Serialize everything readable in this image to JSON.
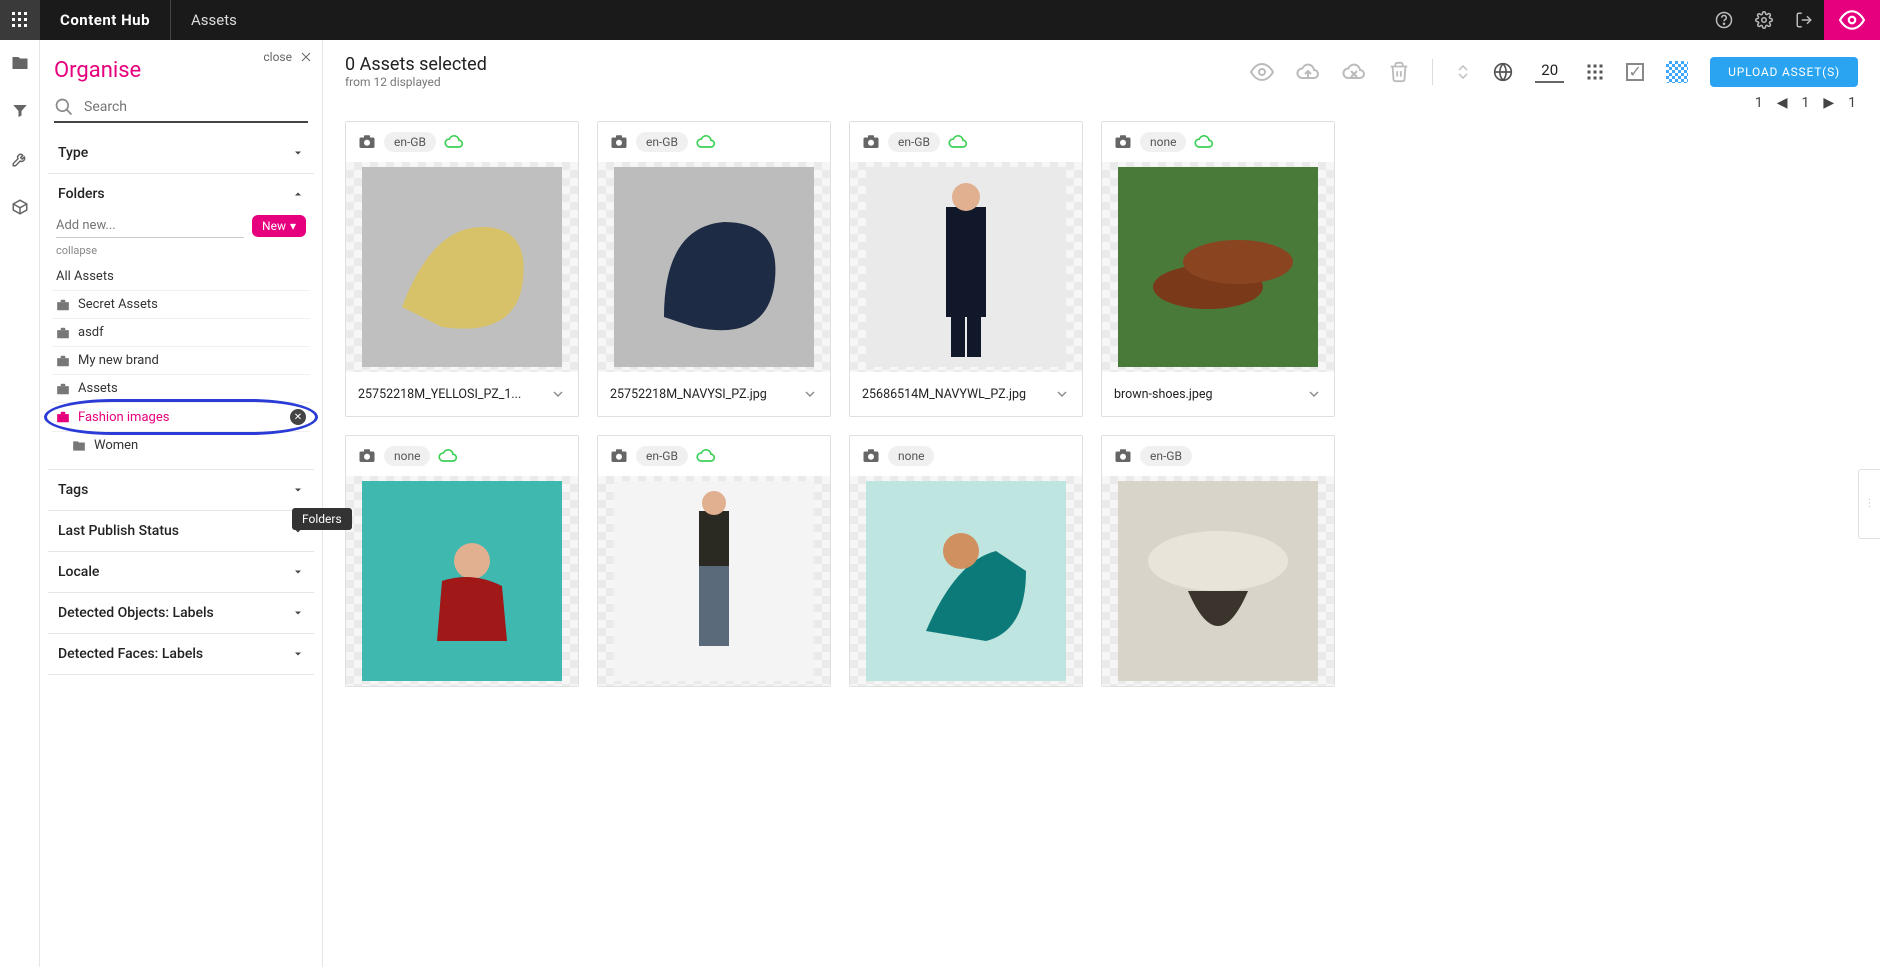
{
  "topbar": {
    "logo": "Content Hub",
    "section": "Assets"
  },
  "organise": {
    "close_label": "close",
    "title": "Organise",
    "search_placeholder": "Search",
    "facets": {
      "type": "Type",
      "folders": "Folders",
      "tags": "Tags",
      "last_publish_status": "Last Publish Status",
      "locale": "Locale",
      "detected_objects": "Detected Objects: Labels",
      "detected_faces": "Detected Faces: Labels"
    },
    "folders_panel": {
      "add_placeholder": "Add new...",
      "new_button": "New",
      "collapse": "collapse",
      "items": [
        {
          "label": "All Assets",
          "icon": "none"
        },
        {
          "label": "Secret Assets",
          "icon": "briefcase"
        },
        {
          "label": "asdf",
          "icon": "briefcase"
        },
        {
          "label": "My new brand",
          "icon": "briefcase"
        },
        {
          "label": "Assets",
          "icon": "briefcase"
        },
        {
          "label": "Fashion images",
          "icon": "briefcase",
          "selected": true
        },
        {
          "label": "Women",
          "icon": "folder",
          "child": true
        }
      ],
      "tooltip": "Folders"
    }
  },
  "header": {
    "selected_line": "0 Assets selected",
    "displayed_line": "from 12 displayed",
    "page_size": "20",
    "upload_button": "UPLOAD ASSET(S)"
  },
  "pagination": {
    "total_left": "1",
    "current": "1",
    "total_right": "1"
  },
  "assets": [
    {
      "locale": "en-GB",
      "cloud": true,
      "filename": "25752218M_YELLOSI_PZ_1...",
      "thumb": "tie-yellow"
    },
    {
      "locale": "en-GB",
      "cloud": true,
      "filename": "25752218M_NAVYSI_PZ.jpg",
      "thumb": "tie-navy"
    },
    {
      "locale": "en-GB",
      "cloud": true,
      "filename": "25686514M_NAVYWL_PZ.jpg",
      "thumb": "suit-man"
    },
    {
      "locale": "none",
      "cloud": true,
      "filename": "brown-shoes.jpeg",
      "thumb": "shoes"
    },
    {
      "locale": "none",
      "cloud": true,
      "filename": "",
      "thumb": "man-red"
    },
    {
      "locale": "en-GB",
      "cloud": true,
      "filename": "",
      "thumb": "man-jeans"
    },
    {
      "locale": "none",
      "cloud": false,
      "filename": "",
      "thumb": "woman-teal"
    },
    {
      "locale": "en-GB",
      "cloud": false,
      "filename": "",
      "thumb": "woman-hat"
    }
  ]
}
